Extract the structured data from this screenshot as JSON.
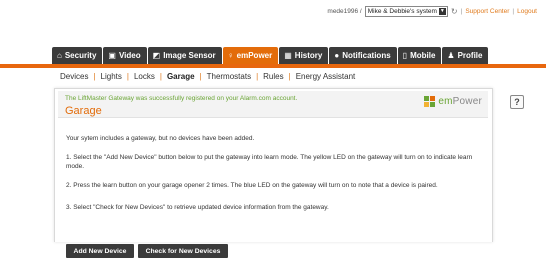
{
  "topbar": {
    "username": "mede1996 /",
    "system_select": "Mike & Debbie's system",
    "support_link": "Support Center",
    "logout_link": "Logout",
    "separator": "|"
  },
  "tabs": [
    {
      "label": "Security",
      "icon": "home-icon"
    },
    {
      "label": "Video",
      "icon": "video-icon"
    },
    {
      "label": "Image Sensor",
      "icon": "camera-icon"
    },
    {
      "label": "emPower",
      "icon": "bulb-icon",
      "active": true
    },
    {
      "label": "History",
      "icon": "history-icon"
    },
    {
      "label": "Notifications",
      "icon": "chat-icon"
    },
    {
      "label": "Mobile",
      "icon": "mobile-icon"
    },
    {
      "label": "Profile",
      "icon": "person-icon"
    }
  ],
  "subnav": {
    "items": [
      "Devices",
      "Lights",
      "Locks",
      "Garage",
      "Thermostats",
      "Rules",
      "Energy Assistant"
    ],
    "current": "Garage",
    "separator": "|"
  },
  "panel": {
    "success_message": "The LiftMaster Gateway was successfully registered on your Alarm.com account.",
    "title": "Garage",
    "brand_prefix": "em",
    "brand_suffix": "Power",
    "intro": "Your sytem includes a gateway, but no devices have been added.",
    "step1": "1. Select the \"Add New Device\" button below to put the gateway into learn mode. The yellow LED on the gateway will turn on to indicate learn mode.",
    "step2": "2. Press the learn button on your garage opener 2 times. The blue LED on the gateway will turn on to note that a device is paired.",
    "step3": "3. Select \"Check for New Devices\" to retrieve updated device information from the gateway.",
    "add_button": "Add New Device",
    "check_button": "Check for New Devices"
  },
  "help_label": "?",
  "colors": {
    "accent": "#e36c0a",
    "success": "#6aa535",
    "tab_bg": "#3b3b3b",
    "link": "#e07b1e"
  }
}
